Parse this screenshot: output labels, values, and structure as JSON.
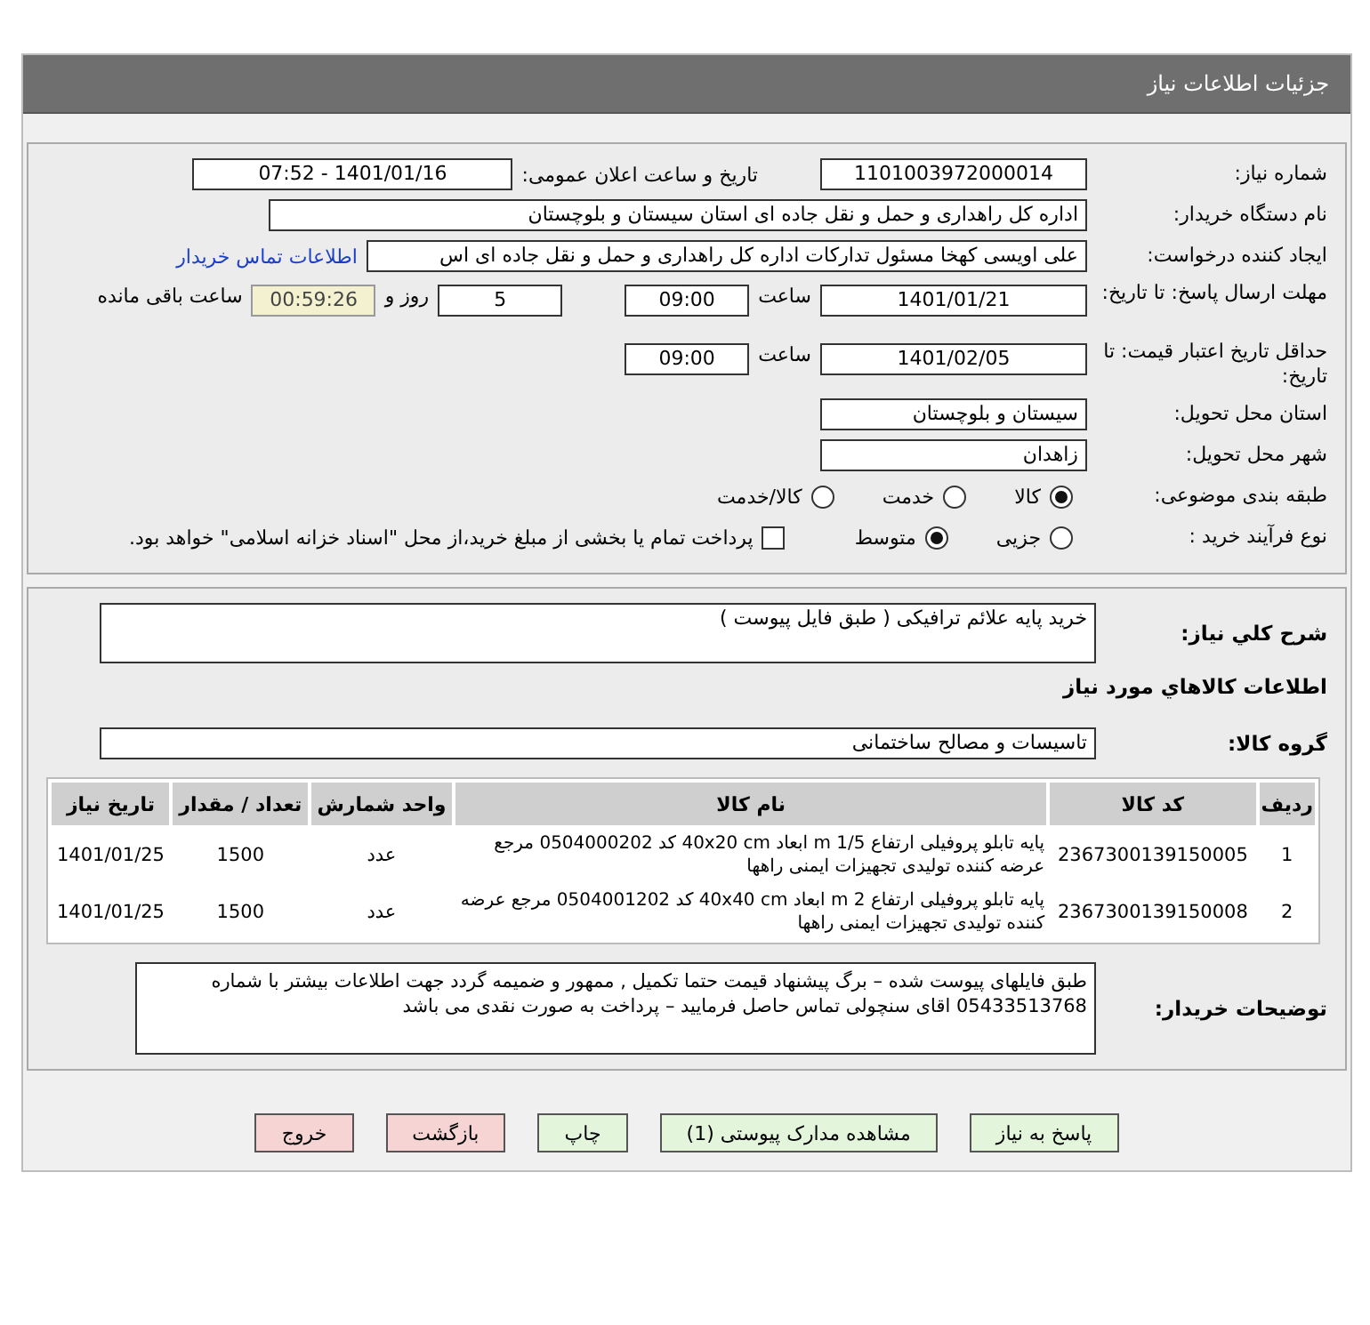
{
  "window": {
    "title": "جزئیات اطلاعات نیاز"
  },
  "details": {
    "need_number": {
      "label": "شماره نیاز:",
      "value": "1101003972000014"
    },
    "announce": {
      "label": "تاریخ و ساعت اعلان عمومی:",
      "value": "1401/01/16 - 07:52"
    },
    "buyer_org": {
      "label": "نام دستگاه خریدار:",
      "value": "اداره کل راهداری و حمل و نقل جاده ای استان سیستان و بلوچستان"
    },
    "requester": {
      "label": "ایجاد کننده درخواست:",
      "value": "علی اویسی کهخا مسئول تدارکات اداره کل راهداری و حمل و نقل جاده ای اس",
      "link": "اطلاعات تماس خریدار"
    },
    "deadline": {
      "label": "مهلت ارسال پاسخ: تا تاریخ:",
      "date": "1401/01/21",
      "time_label": "ساعت",
      "time": "09:00",
      "days": "5",
      "days_label": "روز و",
      "remaining": "00:59:26",
      "remaining_label": "ساعت باقی مانده"
    },
    "validity": {
      "label": "حداقل تاریخ اعتبار قیمت: تا تاریخ:",
      "date": "1401/02/05",
      "time_label": "ساعت",
      "time": "09:00"
    },
    "province": {
      "label": "استان محل تحویل:",
      "value": "سیستان و بلوچستان"
    },
    "city": {
      "label": "شهر محل تحویل:",
      "value": "زاهدان"
    },
    "category": {
      "label": "طبقه بندی موضوعی:",
      "options": [
        {
          "label": "کالا",
          "selected": true
        },
        {
          "label": "خدمت",
          "selected": false
        },
        {
          "label": "کالا/خدمت",
          "selected": false
        }
      ]
    },
    "process": {
      "label": "نوع فرآیند خرید :",
      "options": [
        {
          "label": "جزیی",
          "selected": false
        },
        {
          "label": "متوسط",
          "selected": true
        }
      ],
      "treasury": {
        "checked": false,
        "label": "پرداخت تمام یا بخشی از مبلغ خرید،از محل \"اسناد خزانه اسلامی\" خواهد بود."
      }
    }
  },
  "summary": {
    "label": "شرح کلي نياز:",
    "value": "خرید پایه علائم ترافیکی ( طبق فایل پیوست )"
  },
  "goods_heading": "اطلاعات کالاهاي مورد نياز",
  "goods_group": {
    "label": "گروه کالا:",
    "value": "تاسیسات و مصالح ساختمانی"
  },
  "table": {
    "columns": [
      "ردیف",
      "کد کالا",
      "نام کالا",
      "واحد شمارش",
      "تعداد / مقدار",
      "تاریخ نیاز"
    ],
    "rows": [
      [
        "1",
        "2367300139150005",
        "پایه تابلو پروفیلی ارتفاع m 1/5 ابعاد 40x20 cm کد 0504000202 مرجع عرضه کننده تولیدی تجهیزات ایمنی راهها",
        "عدد",
        "1500",
        "1401/01/25"
      ],
      [
        "2",
        "2367300139150008",
        "پایه تابلو پروفیلی ارتفاع m 2 ابعاد 40x40 cm کد 0504001202 مرجع عرضه کننده تولیدی تجهیزات ایمنی راهها",
        "عدد",
        "1500",
        "1401/01/25"
      ]
    ]
  },
  "buyer_notes": {
    "label": "توضیحات خریدار:",
    "value": "طبق فایلهای پیوست شده – برگ پیشنهاد قیمت حتما تکمیل , ممهور و ضمیمه گردد جهت اطلاعات بیشتر با شماره 05433513768 اقای سنچولی تماس حاصل فرمایید – پرداخت به صورت نقدی می باشد"
  },
  "buttons": [
    {
      "label": "پاسخ به نیاز",
      "kind": "action"
    },
    {
      "label": "مشاهده مدارک پیوستی (1)",
      "kind": "action"
    },
    {
      "label": "چاپ",
      "kind": "action"
    },
    {
      "label": "بازگشت",
      "kind": "exit"
    },
    {
      "label": "خروج",
      "kind": "exit"
    }
  ]
}
